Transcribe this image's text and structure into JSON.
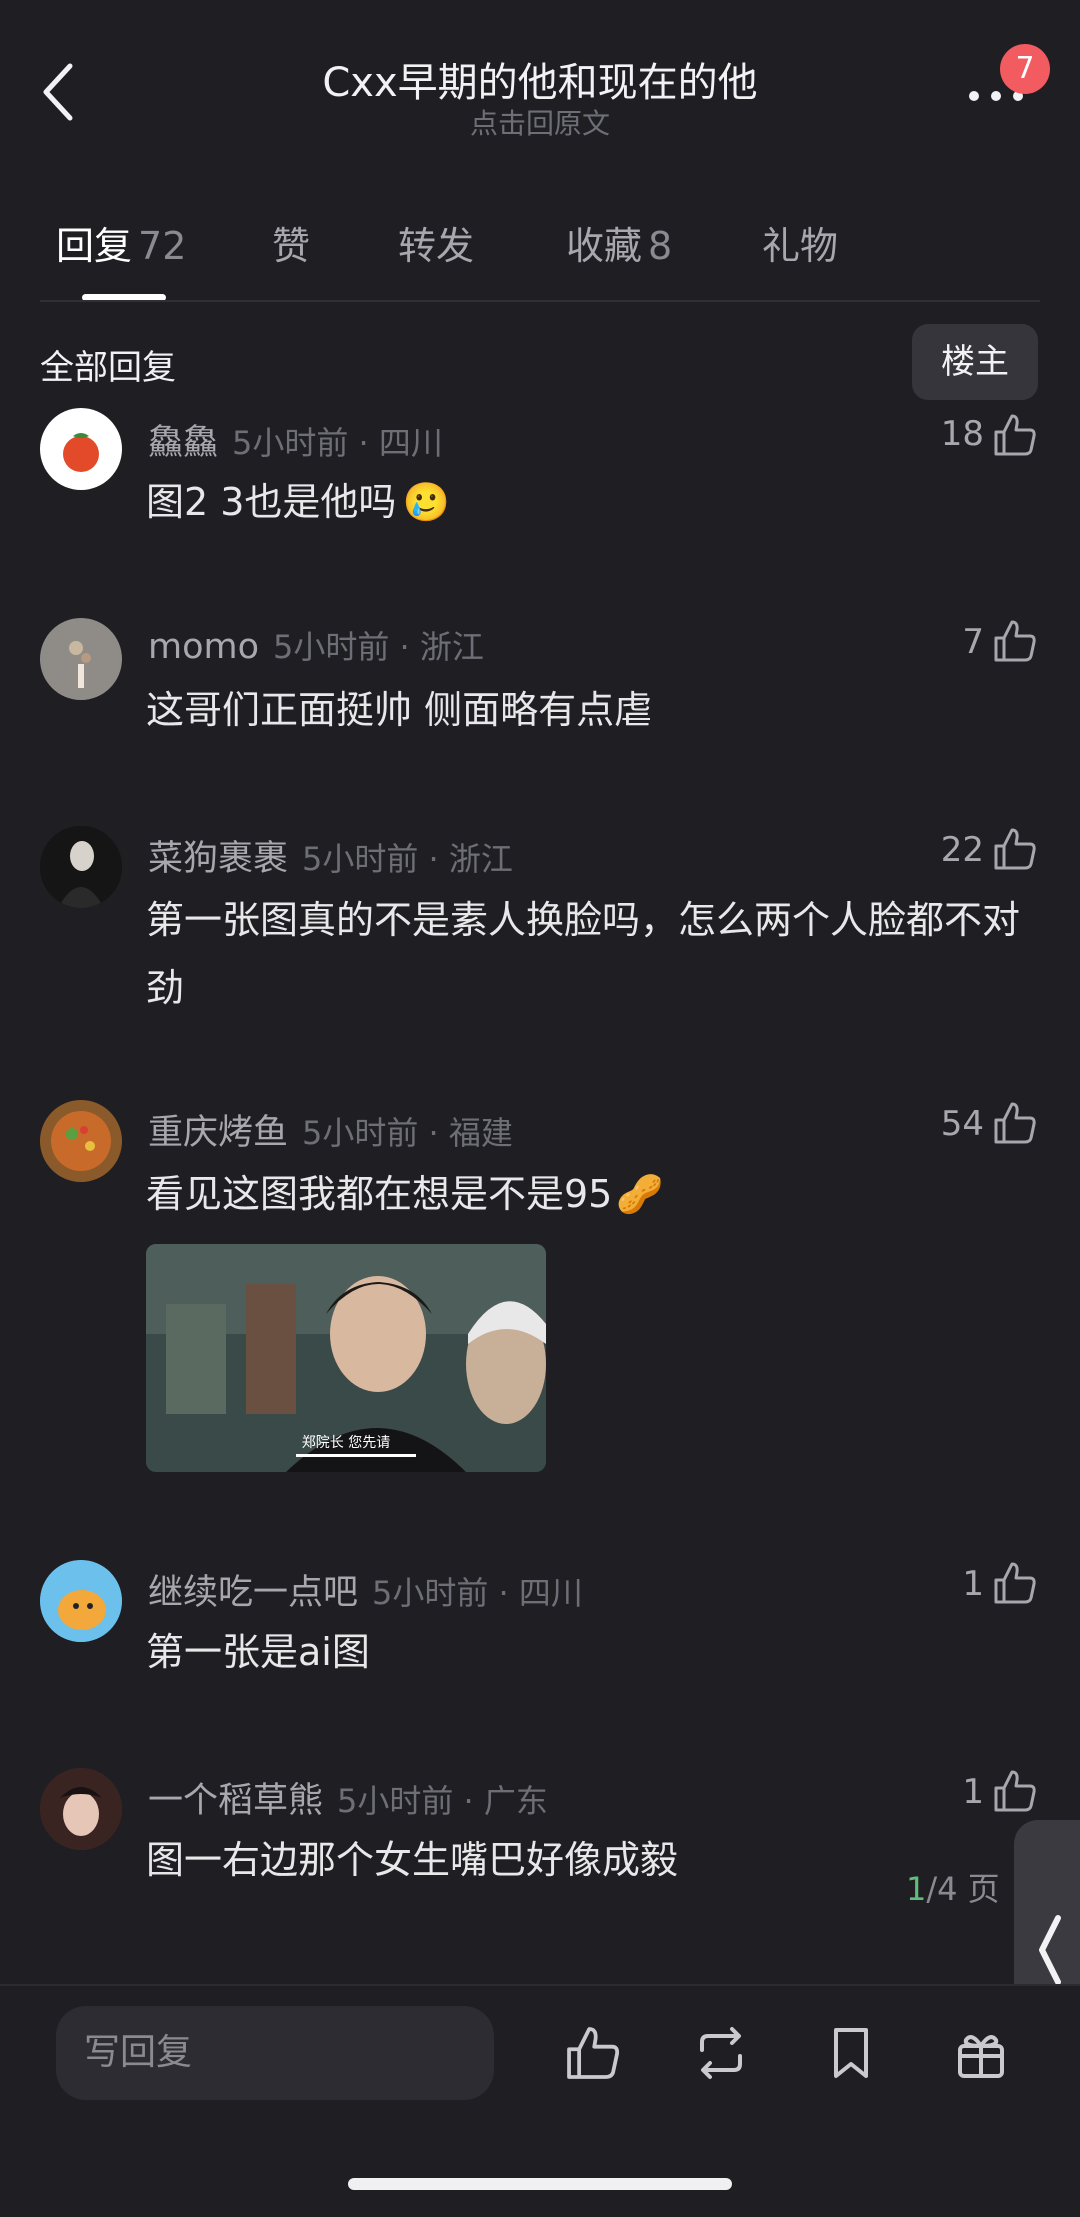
{
  "header": {
    "title": "Cxx早期的他和现在的他",
    "subtitle": "点击回原文",
    "badge": "7"
  },
  "tabs": [
    {
      "label": "回复",
      "count": "72"
    },
    {
      "label": "赞",
      "count": ""
    },
    {
      "label": "转发",
      "count": ""
    },
    {
      "label": "收藏",
      "count": "8"
    },
    {
      "label": "礼物",
      "count": ""
    }
  ],
  "section": {
    "title": "全部回复",
    "filter_button": "楼主"
  },
  "comments": [
    {
      "name": "鱻鱻",
      "meta": "5小时前 · 四川",
      "text": "图2 3也是他吗",
      "emoji": "🥲",
      "likes": "18"
    },
    {
      "name": "momo",
      "meta": "5小时前 · 浙江",
      "text": "这哥们正面挺帅 侧面略有点虐",
      "likes": "7"
    },
    {
      "name": "菜狗裹裹",
      "meta": "5小时前 · 浙江",
      "text": "第一张图真的不是素人换脸吗，怎么两个人脸都不对劲",
      "likes": "22"
    },
    {
      "name": "重庆烤鱼",
      "meta": "5小时前 · 福建",
      "text": "看见这图我都在想是不是95",
      "emoji": "🥜",
      "likes": "54",
      "image_caption": "郑院长 您先请"
    },
    {
      "name": "继续吃一点吧",
      "meta": "5小时前 · 四川",
      "text": "第一张是ai图",
      "likes": "1"
    },
    {
      "name": "一个稻草熊",
      "meta": "5小时前 · 广东",
      "text": "图一右边那个女生嘴巴好像成毅",
      "likes": "1"
    }
  ],
  "pagination": {
    "current": "1",
    "rest": "/4 页"
  },
  "bottom": {
    "reply_placeholder": "写回复"
  },
  "colors": {
    "background": "#1e1e23",
    "badge": "#f25b60",
    "page_current": "#5fbf7a"
  },
  "icons": [
    "back-arrow-icon",
    "more-dots-icon",
    "thumb-up-icon",
    "repost-icon",
    "bookmark-icon",
    "gift-icon",
    "chevron-left-icon"
  ]
}
